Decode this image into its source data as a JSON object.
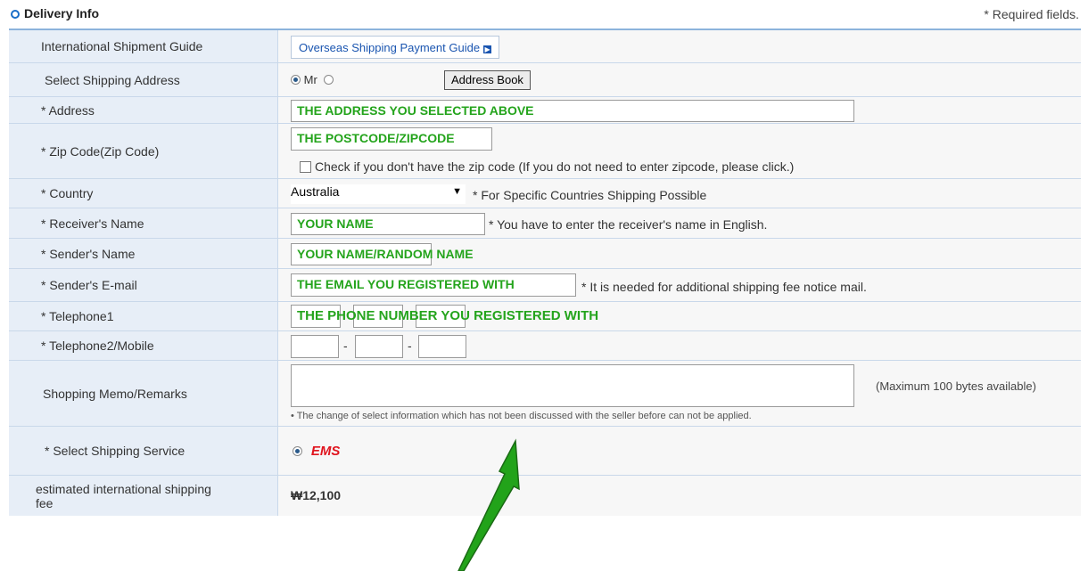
{
  "header": {
    "title": "Delivery Info",
    "required_note": "* Required fields."
  },
  "rows": {
    "guide": {
      "label": "International Shipment Guide",
      "button": "Overseas Shipping Payment Guide"
    },
    "select_address": {
      "label": "Select Shipping Address",
      "radio1": "Mr",
      "address_book": "Address Book"
    },
    "address": {
      "label": "* Address",
      "value": "THE ADDRESS YOU SELECTED ABOVE"
    },
    "zip": {
      "label": "* Zip Code(Zip Code)",
      "value": "THE POSTCODE/ZIPCODE",
      "checkbox_label": "Check if you don't have the zip code (If you do not need to enter zipcode, please click.)"
    },
    "country": {
      "label": "* Country",
      "value": "Australia",
      "note": "* For Specific Countries Shipping Possible"
    },
    "receiver": {
      "label": "* Receiver's Name",
      "value": "YOUR NAME",
      "note": "* You have to enter the receiver's name in English."
    },
    "sender": {
      "label": "* Sender's Name",
      "value": "YOUR NAME/RANDOM NAME"
    },
    "email": {
      "label": "* Sender's E-mail",
      "value": "THE EMAIL YOU REGISTERED WITH",
      "note": "* It is needed for additional shipping fee notice mail."
    },
    "tel1": {
      "label": "* Telephone1",
      "value": "THE PHONE NUMBER YOU REGISTERED WITH",
      "sep": "-"
    },
    "tel2": {
      "label": "* Telephone2/Mobile",
      "sep": "-"
    },
    "memo": {
      "label": "Shopping Memo/Remarks",
      "max_note": "(Maximum 100 bytes available)",
      "sub_note": "• The change of select information which has not been discussed with the seller before can not be applied."
    },
    "service": {
      "label": "* Select Shipping Service",
      "value": "EMS"
    },
    "fee": {
      "label": "estimated international shipping fee",
      "value": "₩12,100"
    }
  },
  "colors": {
    "label_bg": "#e7eef7",
    "value_bg": "#f7f7f7",
    "annotation": "#24a41c",
    "arrow": "#22a31a",
    "ems": "#e0141e",
    "border": "#c9d8ea"
  }
}
